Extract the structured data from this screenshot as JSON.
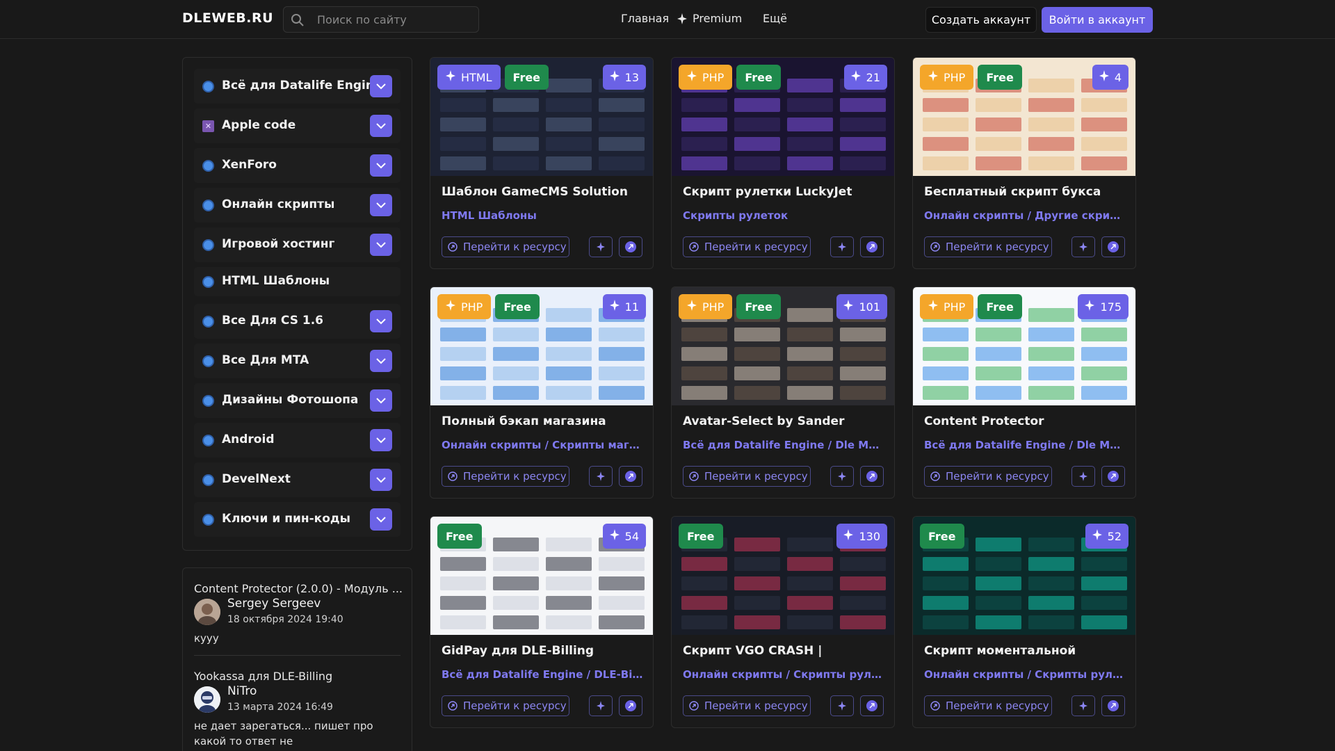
{
  "header": {
    "logo": "DLEWEB.RU",
    "search_placeholder": "Поиск по сайту",
    "nav_home": "Главная",
    "nav_premium": "Premium",
    "nav_more": "Ещё",
    "create_account": "Создать аккаунт",
    "login": "Войти в аккаунт"
  },
  "sidebar": {
    "categories": [
      {
        "label": "Всё для Datalife Engine",
        "expandable": true
      },
      {
        "label": "Apple code",
        "expandable": true
      },
      {
        "label": "XenForo",
        "expandable": true
      },
      {
        "label": "Онлайн скрипты",
        "expandable": true
      },
      {
        "label": "Игровой хостинг",
        "expandable": true
      },
      {
        "label": "HTML Шаблоны",
        "expandable": false
      },
      {
        "label": "Все Для CS 1.6",
        "expandable": true
      },
      {
        "label": "Все Для MTA",
        "expandable": true
      },
      {
        "label": "Дизайны Фотошопа",
        "expandable": true
      },
      {
        "label": "Android",
        "expandable": true
      },
      {
        "label": "DevelNext",
        "expandable": true
      },
      {
        "label": "Ключи и пин-коды",
        "expandable": true
      }
    ]
  },
  "comments": [
    {
      "title": "Content Protector (2.0.0) - Модуль ...",
      "author": "Sergey Sergeev",
      "date": "18 октября 2024 19:40",
      "text": "кууу"
    },
    {
      "title": "Yookassa для DLE-Billing",
      "author": "NiTro",
      "date": "13 марта 2024 16:49",
      "text": "не дает зарегаться... пишет про какой то ответ не"
    }
  ],
  "cards": [
    {
      "lang": "HTML",
      "free": "Free",
      "count": "13",
      "title": "Шаблон GameCMS Solution",
      "category": "HTML Шаблоны",
      "goto": "Перейти к ресурсу"
    },
    {
      "lang": "PHP",
      "free": "Free",
      "count": "21",
      "title": "Скрипт рулетки LuckyJet",
      "category": "Скрипты рулеток",
      "goto": "Перейти к ресурсу"
    },
    {
      "lang": "PHP",
      "free": "Free",
      "count": "4",
      "title": "Бесплатный скрипт букса",
      "category": "Онлайн скрипты / Другие скрипты",
      "goto": "Перейти к ресурсу"
    },
    {
      "lang": "PHP",
      "free": "Free",
      "count": "11",
      "title": "Полный бэкап магазина",
      "category": "Онлайн скрипты / Скрипты магазин...",
      "goto": "Перейти к ресурсу"
    },
    {
      "lang": "PHP",
      "free": "Free",
      "count": "101",
      "title": "Avatar-Select by Sander",
      "category": "Всё для Datalife Engine / Dle Модули",
      "goto": "Перейти к ресурсу"
    },
    {
      "lang": "PHP",
      "free": "Free",
      "count": "175",
      "title": "Content Protector",
      "category": "Всё для Datalife Engine / Dle Модули",
      "goto": "Перейти к ресурсу"
    },
    {
      "lang": "",
      "free": "Free",
      "count": "54",
      "title": "GidPay для DLE-Billing",
      "category": "Всё для Datalife Engine / DLE-Billing",
      "goto": "Перейти к ресурсу"
    },
    {
      "lang": "",
      "free": "Free",
      "count": "130",
      "title": "Скрипт VGO CRASH |",
      "category": "Онлайн скрипты / Скрипты рулеток",
      "goto": "Перейти к ресурсу"
    },
    {
      "lang": "",
      "free": "Free",
      "count": "52",
      "title": "Скрипт моментальной",
      "category": "Онлайн скрипты / Скрипты рулеток",
      "goto": "Перейти к ресурсу"
    }
  ],
  "colors": {
    "accent": "#6b62e6",
    "php": "#f4a62a",
    "free": "#1f8a4c",
    "background": "#191919"
  }
}
